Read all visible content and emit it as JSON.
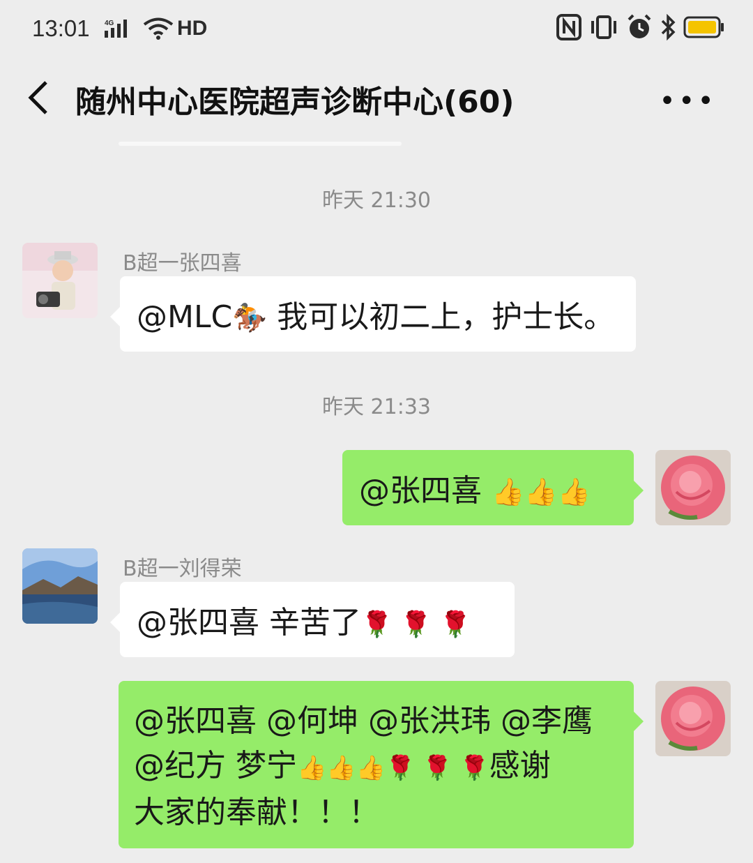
{
  "status_bar": {
    "time": "13:01",
    "network": "4G",
    "hd": "HD"
  },
  "header": {
    "title": "随州中心医院超声诊断中心(60)",
    "more_icon": "ellipsis-icon",
    "back_icon": "chevron-left-icon"
  },
  "messages": [
    {
      "type": "timestamp",
      "text": "昨天 21:30"
    },
    {
      "type": "incoming",
      "sender": "B超一张四喜",
      "text_a": "@MLC",
      "emoji_a": "🏇",
      "text_b": " 我可以初二上，护士长。"
    },
    {
      "type": "timestamp",
      "text": "昨天 21:33"
    },
    {
      "type": "outgoing",
      "text_a": "@张四喜 ",
      "emoji_a": "👍👍👍"
    },
    {
      "type": "incoming",
      "sender": "B超一刘得荣",
      "text_a": "@张四喜  辛苦了",
      "emoji_a": "🌹 🌹 🌹"
    },
    {
      "type": "outgoing",
      "line1": "@张四喜 @何坤 @张洪玮 @李鹰",
      "line2_a": "@纪方  梦宁",
      "line2_emoji": "👍👍👍🌹 🌹 🌹",
      "line2_b": "感谢",
      "line3": "大家的奉献！！！"
    }
  ],
  "colors": {
    "background": "#ededed",
    "outgoing_bubble": "#95ec69",
    "incoming_bubble": "#ffffff"
  }
}
